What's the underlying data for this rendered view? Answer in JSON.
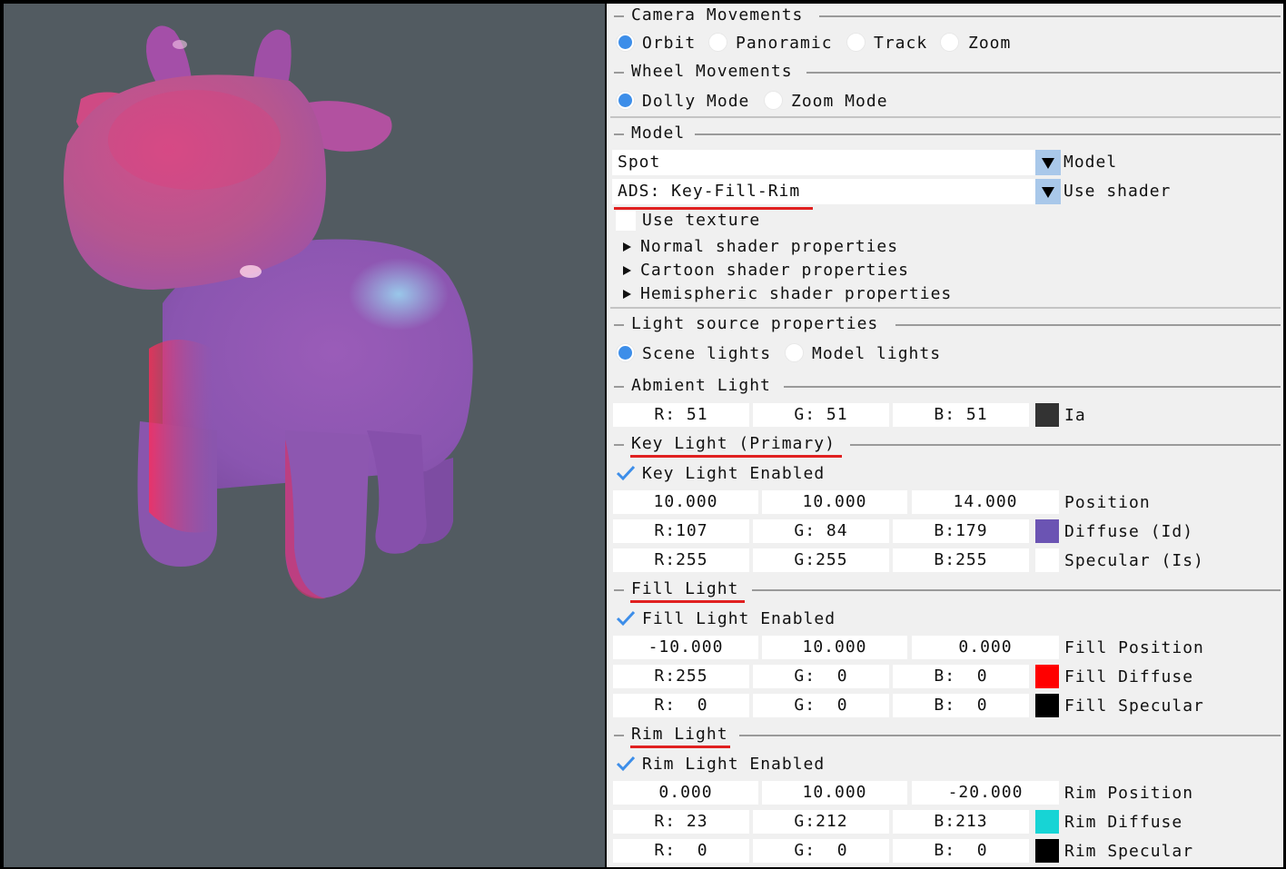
{
  "camera": {
    "title": "Camera Movements",
    "options": [
      "Orbit",
      "Panoramic",
      "Track",
      "Zoom"
    ],
    "selected": "Orbit"
  },
  "wheel": {
    "title": "Wheel Movements",
    "options": [
      "Dolly Mode",
      "Zoom Mode"
    ],
    "selected": "Dolly Mode"
  },
  "model": {
    "title": "Model",
    "model_value": "Spot",
    "model_label": "Model",
    "shader_value": "ADS: Key-Fill-Rim",
    "shader_label": "Use shader",
    "use_texture": "Use texture",
    "sections": [
      "Normal shader properties",
      "Cartoon shader properties",
      "Hemispheric shader properties"
    ]
  },
  "light_source": {
    "title": "Light source properties",
    "options": [
      "Scene lights",
      "Model lights"
    ],
    "selected": "Scene lights"
  },
  "ambient": {
    "title": "Abmient Light",
    "r": "R: 51",
    "g": "G: 51",
    "b": "B: 51",
    "label": "Ia",
    "color": "#333333"
  },
  "key": {
    "title": "Key Light (Primary)",
    "enabled_label": "Key Light Enabled",
    "position": [
      "10.000",
      "10.000",
      "14.000"
    ],
    "position_label": "Position",
    "diffuse": {
      "r": "R:107",
      "g": "G: 84",
      "b": "B:179",
      "label": "Diffuse (Id)",
      "color": "#6b54b3"
    },
    "specular": {
      "r": "R:255",
      "g": "G:255",
      "b": "B:255",
      "label": "Specular (Is)",
      "color": "#ffffff"
    }
  },
  "fill": {
    "title": "Fill Light",
    "enabled_label": "Fill Light Enabled",
    "position": [
      "-10.000",
      "10.000",
      "0.000"
    ],
    "position_label": "Fill Position",
    "diffuse": {
      "r": "R:255",
      "g": "G:  0",
      "b": "B:  0",
      "label": "Fill Diffuse",
      "color": "#ff0000"
    },
    "specular": {
      "r": "R:  0",
      "g": "G:  0",
      "b": "B:  0",
      "label": "Fill Specular",
      "color": "#000000"
    }
  },
  "rim": {
    "title": "Rim Light",
    "enabled_label": "Rim Light Enabled",
    "position": [
      "0.000",
      "10.000",
      "-20.000"
    ],
    "position_label": "Rim Position",
    "diffuse": {
      "r": "R: 23",
      "g": "G:212",
      "b": "B:213",
      "label": "Rim Diffuse",
      "color": "#17d4d5"
    },
    "specular": {
      "r": "R:  0",
      "g": "G:  0",
      "b": "B:  0",
      "label": "Rim Specular",
      "color": "#000000"
    }
  },
  "colors": {
    "viewport_bg": "#525b61",
    "accent": "#3d8ee9",
    "annotation": "#e02020"
  }
}
